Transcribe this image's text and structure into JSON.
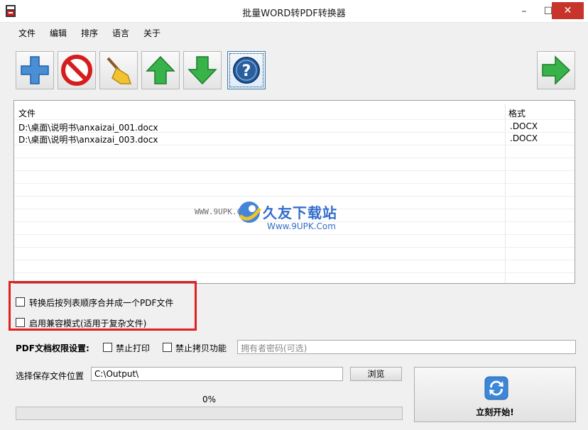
{
  "window": {
    "title": "批量WORD转PDF转换器",
    "minimize": "–",
    "maximize": "☐",
    "close": "✕"
  },
  "menu": [
    "文件",
    "编辑",
    "排序",
    "语言",
    "关于"
  ],
  "toolbar": {
    "buttons": [
      {
        "name": "add-file-button",
        "icon": "plus-icon"
      },
      {
        "name": "remove-button",
        "icon": "no-entry-icon"
      },
      {
        "name": "clear-button",
        "icon": "broom-icon"
      },
      {
        "name": "move-up-button",
        "icon": "arrow-up-icon"
      },
      {
        "name": "move-down-button",
        "icon": "arrow-down-icon"
      },
      {
        "name": "help-button",
        "icon": "question-icon"
      },
      {
        "name": "next-button",
        "icon": "arrow-right-icon"
      }
    ]
  },
  "filelist": {
    "headers": {
      "file": "文件",
      "format": "格式"
    },
    "rows": [
      {
        "file": "D:\\桌面\\说明书\\anxaizai_001.docx",
        "format": ".DOCX"
      },
      {
        "file": "D:\\桌面\\说明书\\anxaizai_003.docx",
        "format": ".DOCX"
      }
    ]
  },
  "watermark": {
    "left_text": "WWW.9UPK.COM",
    "title": "久友下载站",
    "sub": "Www.9UPK.Com"
  },
  "options": {
    "merge_label": "转换后按列表顺序合并成一个PDF文件",
    "compat_label": "启用兼容模式(适用于复杂文件)"
  },
  "permissions": {
    "title": "PDF文档权限设置:",
    "no_print": "禁止打印",
    "no_copy": "禁止拷贝功能",
    "owner_password_placeholder": "拥有者密码(可选)"
  },
  "output": {
    "label": "选择保存文件位置",
    "path": "C:\\Output\\",
    "browse": "浏览"
  },
  "progress": {
    "text": "0%",
    "value": 0
  },
  "start": {
    "label": "立刻开始!"
  },
  "colors": {
    "close": "#c7342b",
    "highlight_box": "#e02020",
    "watermark": "#2a67c9"
  }
}
